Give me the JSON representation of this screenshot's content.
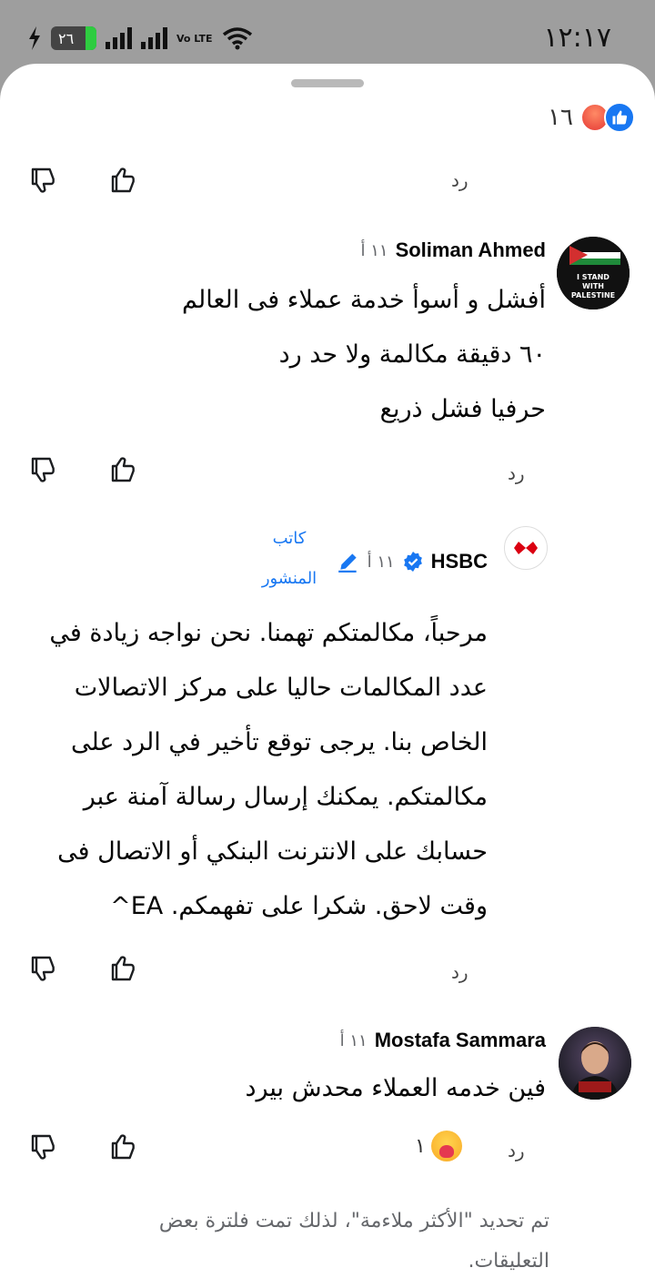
{
  "status_bar": {
    "time": "١٢:١٧",
    "battery_level": "٢٦",
    "network": "Vo LTE"
  },
  "post_reactions": {
    "count": "١٦",
    "types": [
      "like-icon",
      "angry-icon"
    ]
  },
  "actions": {
    "reply_label": "رد"
  },
  "comments": [
    {
      "author": "Soliman Ahmed",
      "time": "١١ أ",
      "avatar_text": [
        "I STAND",
        "WITH",
        "PALESTINE"
      ],
      "lines": [
        "أفشل و أسوأ خدمة عملاء فى العالم",
        "٦٠ دقيقة مكالمة ولا حد رد",
        "حرفيا فشل ذريع"
      ]
    },
    {
      "author": "HSBC",
      "time": "١١ أ",
      "verified": true,
      "badge": [
        "كاتب",
        "المنشور"
      ],
      "lines": [
        "مرحباً، مكالمتكم تهمنا. نحن نواجه زيادة في",
        "عدد المكالمات حاليا على مركز الاتصالات",
        "الخاص بنا. يرجى توقع تأخير في الرد على",
        "مكالمتكم. يمكنك إرسال رسالة آمنة عبر",
        "حسابك على الانترنت البنكي أو الاتصال فى",
        "وقت لاحق. شكرا على تفهمكم. EA^"
      ]
    },
    {
      "author": "Mostafa Sammara",
      "time": "١١ أ",
      "lines": [
        "فين خدمه العملاء محدش بيرد"
      ],
      "reaction_count": "١",
      "reaction_icon": "care-icon"
    }
  ],
  "footer_note": [
    "تم تحديد \"الأكثر ملاءمة\"، لذلك تمت فلترة بعض",
    "التعليقات."
  ],
  "colors": {
    "accent": "#1877f2",
    "meta": "#65676b",
    "hsbc_red": "#db0011"
  }
}
